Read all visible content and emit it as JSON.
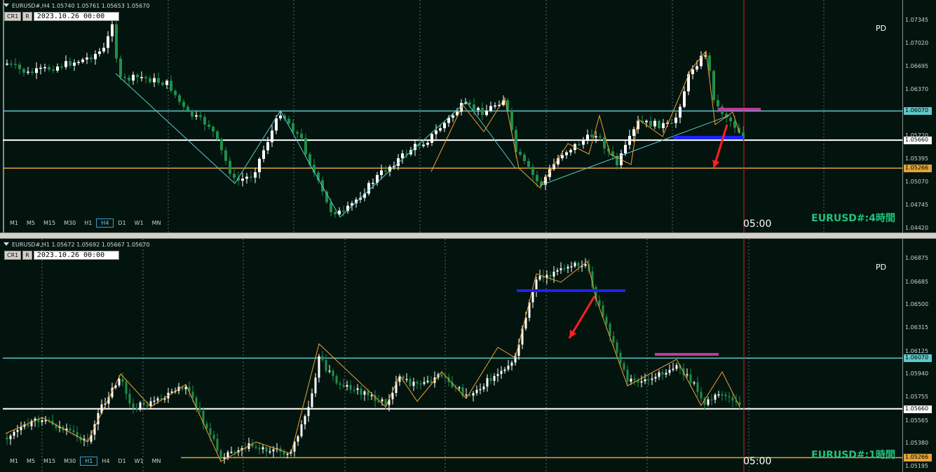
{
  "top_pane": {
    "header": "EURUSD#,H4  1.05740 1.05761 1.05653 1.05670",
    "tool_cr": "CR1",
    "tool_r": "R",
    "date": "2023.10.26 00:00",
    "pd": "PD",
    "title": "EURUSD#:4時間",
    "time_label": "05:00",
    "timeframes": [
      "M1",
      "M5",
      "M15",
      "M30",
      "H1",
      "H4",
      "D1",
      "W1",
      "MN"
    ],
    "active_tf": "H4",
    "y_ticks": [
      {
        "label": "1.07345",
        "value": 1.07345
      },
      {
        "label": "1.07020",
        "value": 1.0702
      },
      {
        "label": "1.06695",
        "value": 1.06695
      },
      {
        "label": "1.06370",
        "value": 1.0637
      },
      {
        "label": "1.05720",
        "value": 1.0572
      },
      {
        "label": "1.05395",
        "value": 1.05395
      },
      {
        "label": "1.05070",
        "value": 1.0507
      },
      {
        "label": "1.04745",
        "value": 1.04745
      },
      {
        "label": "1.04420",
        "value": 1.0442
      }
    ],
    "price_tags": [
      {
        "label": "1.06070",
        "value": 1.0607,
        "color": "#5ec9c9"
      },
      {
        "label": "1.05660",
        "value": 1.0566,
        "color": "#ffffff"
      },
      {
        "label": "1.05266",
        "value": 1.05266,
        "color": "#e2a53a"
      }
    ]
  },
  "bottom_pane": {
    "header": "EURUSD#,H1  1.05672 1.05692 1.05667 1.05670",
    "tool_cr": "CR1",
    "tool_r": "R",
    "date": "2023.10.26 00:00",
    "pd": "PD",
    "title": "EURUSD#:1時間",
    "time_label": "05:00",
    "timeframes": [
      "M1",
      "M5",
      "M15",
      "M30",
      "H1",
      "H4",
      "D1",
      "W1",
      "MN"
    ],
    "active_tf": "H1",
    "y_ticks": [
      {
        "label": "1.06875",
        "value": 1.06875
      },
      {
        "label": "1.06685",
        "value": 1.06685
      },
      {
        "label": "1.06500",
        "value": 1.065
      },
      {
        "label": "1.06315",
        "value": 1.06315
      },
      {
        "label": "1.06125",
        "value": 1.06125
      },
      {
        "label": "1.05940",
        "value": 1.0594
      },
      {
        "label": "1.05755",
        "value": 1.05755
      },
      {
        "label": "1.05565",
        "value": 1.05565
      },
      {
        "label": "1.05380",
        "value": 1.0538
      },
      {
        "label": "1.05195",
        "value": 1.05195
      }
    ],
    "price_tags": [
      {
        "label": "1.06070",
        "value": 1.0607,
        "color": "#5ec9c9"
      },
      {
        "label": "1.05660",
        "value": 1.0566,
        "color": "#ffffff"
      },
      {
        "label": "1.05266",
        "value": 1.05266,
        "color": "#e2a53a"
      }
    ]
  },
  "colors": {
    "background": "#03140f",
    "bull_candle": "#ffffff",
    "bear_candle": "#1f8f4a",
    "support_cyan": "#5ec9c9",
    "level_white": "#ffffff",
    "level_orange": "#e2a53a",
    "zigzag_orange": "#f0a030",
    "trend_cyan": "#5ec9c9",
    "zone_blue": "#1a22ff",
    "zone_magenta": "#c2389c",
    "arrow_red": "#ff2020",
    "vline_red": "#d42020",
    "title_green": "#21c27d"
  }
}
